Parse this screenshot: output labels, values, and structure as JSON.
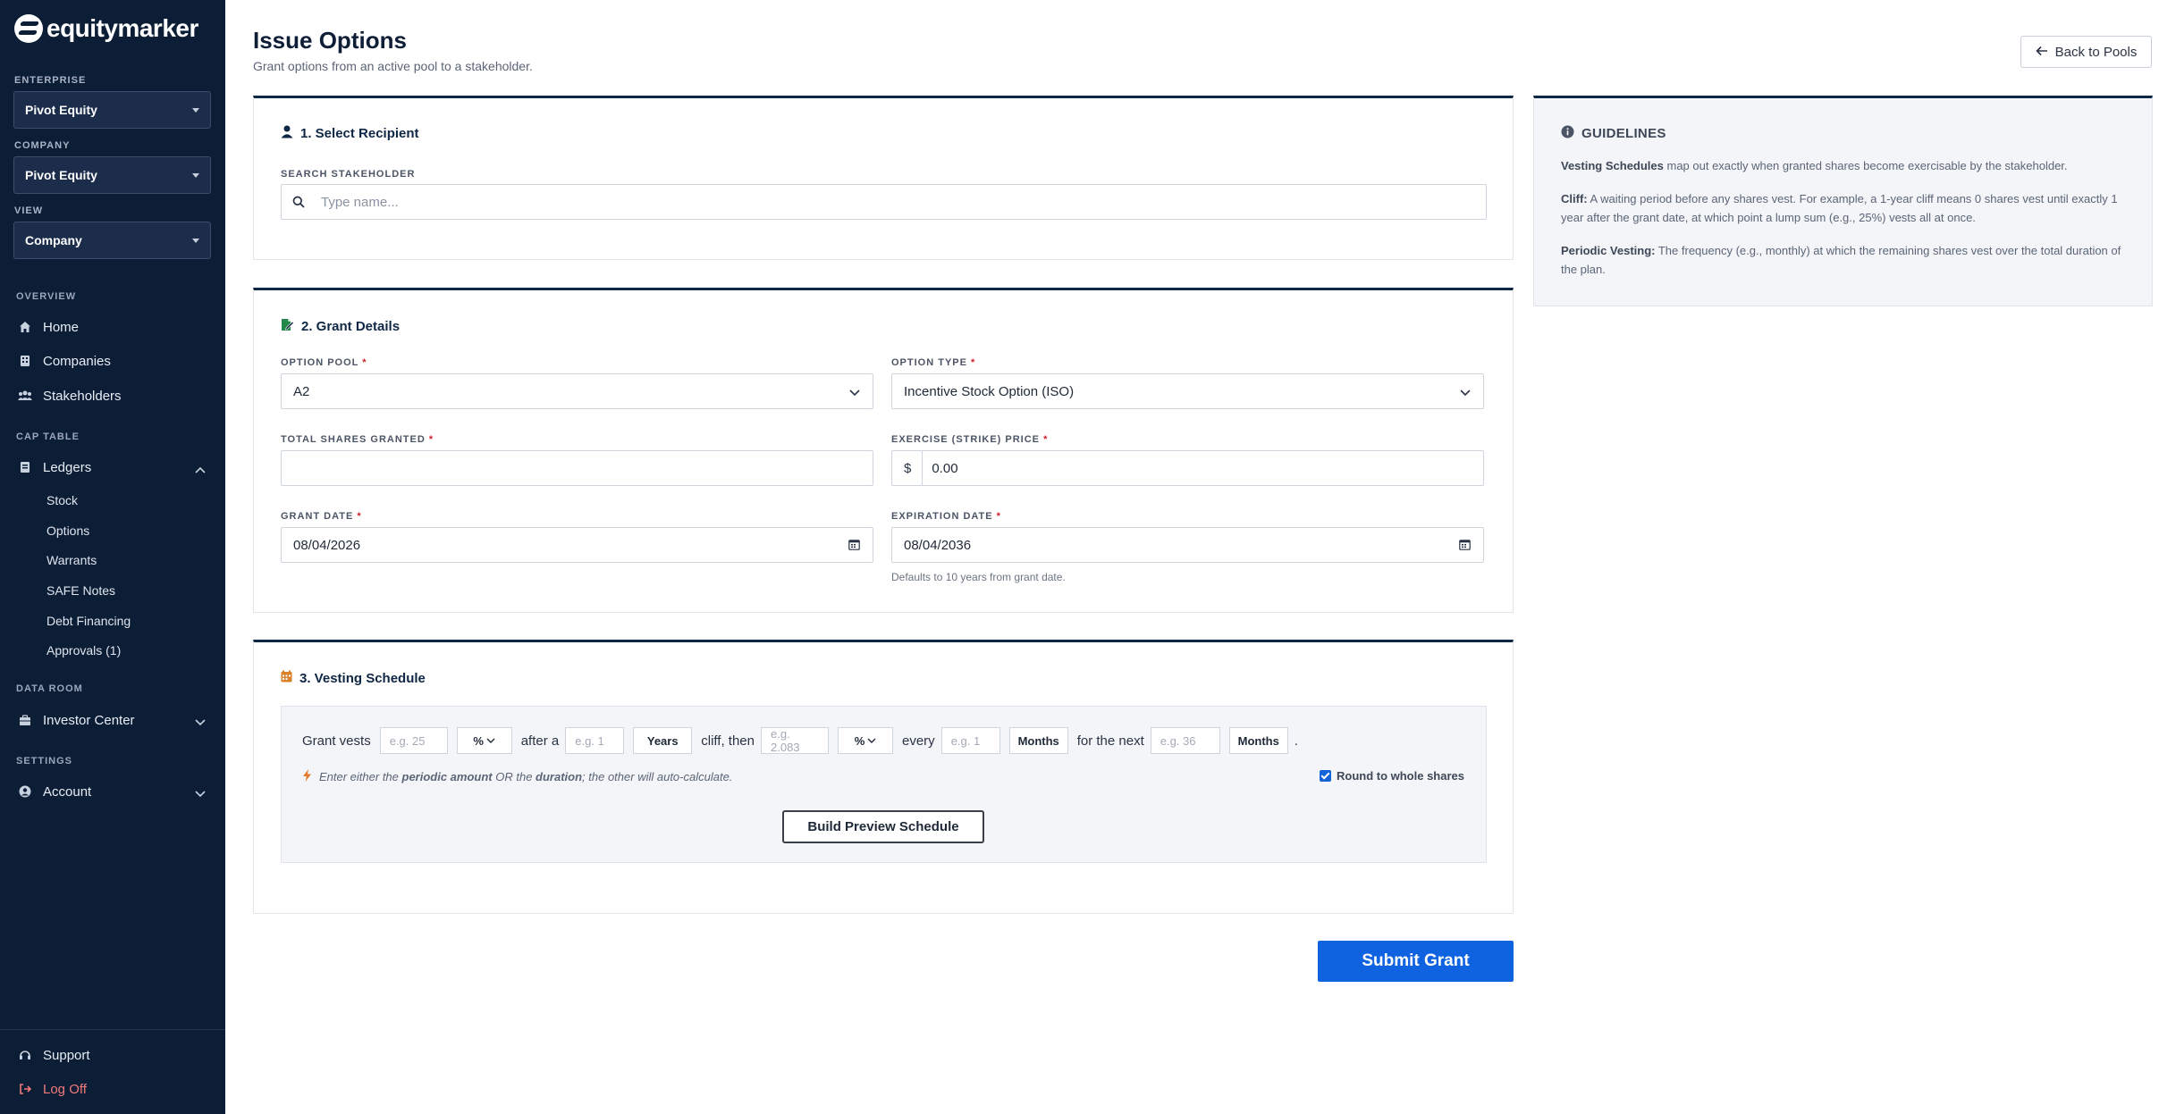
{
  "brand": {
    "name": "equitymarker"
  },
  "sidebar": {
    "enterprise_label": "ENTERPRISE",
    "enterprise_value": "Pivot Equity",
    "company_label": "COMPANY",
    "company_value": "Pivot Equity",
    "view_label": "VIEW",
    "view_value": "Company",
    "overview_label": "OVERVIEW",
    "nav": {
      "home": "Home",
      "companies": "Companies",
      "stakeholders": "Stakeholders"
    },
    "cap_table_label": "CAP TABLE",
    "ledgers": "Ledgers",
    "ledger_items": [
      "Stock",
      "Options",
      "Warrants",
      "SAFE Notes",
      "Debt Financing",
      "Approvals (1)"
    ],
    "data_room_label": "DATA ROOM",
    "investor_center": "Investor Center",
    "settings_label": "SETTINGS",
    "account": "Account",
    "support": "Support",
    "log_off": "Log Off"
  },
  "header": {
    "title": "Issue Options",
    "subtitle": "Grant options from an active pool to a stakeholder.",
    "back_label": "Back to Pools"
  },
  "recipient": {
    "title": "1. Select Recipient",
    "search_label": "SEARCH STAKEHOLDER",
    "search_placeholder": "Type name..."
  },
  "grant": {
    "title": "2. Grant Details",
    "pool_label": "OPTION POOL",
    "pool_value": "A2",
    "type_label": "OPTION TYPE",
    "type_value": "Incentive Stock Option (ISO)",
    "shares_label": "TOTAL SHARES GRANTED",
    "shares_value": "",
    "price_label": "EXERCISE (STRIKE) PRICE",
    "price_prefix": "$",
    "price_value": "0.00",
    "grant_date_label": "GRANT DATE",
    "grant_date_value": "08/04/2026",
    "exp_date_label": "EXPIRATION DATE",
    "exp_date_value": "08/04/2036",
    "exp_hint": "Defaults to 10 years from grant date.",
    "required_mark": "*"
  },
  "vesting": {
    "title": "3. Vesting Schedule",
    "t_grant_vests": "Grant vests",
    "cliff_amount_placeholder": "e.g. 25",
    "cliff_unit": "%",
    "t_after_a": "after a",
    "cliff_duration_placeholder": "e.g. 1",
    "cliff_duration_unit": "Years",
    "t_cliff_then": "cliff, then",
    "periodic_amount_placeholder": "e.g. 2.083",
    "periodic_unit": "%",
    "t_every": "every",
    "frequency_placeholder": "e.g. 1",
    "frequency_unit": "Months",
    "t_for_next": "for the next",
    "duration_placeholder": "e.g. 36",
    "duration_unit": "Months",
    "t_period": ".",
    "note_pre": "Enter either the ",
    "note_b1": "periodic amount",
    "note_mid": " OR the ",
    "note_b2": "duration",
    "note_post": "; the other will auto-calculate.",
    "round_label": "Round to whole shares",
    "round_checked": true,
    "build_label": "Build Preview Schedule"
  },
  "submit_label": "Submit Grant",
  "guidelines": {
    "title": "GUIDELINES",
    "p1_b": "Vesting Schedules",
    "p1": " map out exactly when granted shares become exercisable by the stakeholder.",
    "p2_b": "Cliff:",
    "p2": " A waiting period before any shares vest. For example, a 1-year cliff means 0 shares vest until exactly 1 year after the grant date, at which point a lump sum (e.g., 25%) vests all at once.",
    "p3_b": "Periodic Vesting:",
    "p3": " The frequency (e.g., monthly) at which the remaining shares vest over the total duration of the plan."
  },
  "colors": {
    "sidebar_bg": "#0c1d36",
    "accent": "#0f63e0",
    "required": "#d11f2e"
  }
}
